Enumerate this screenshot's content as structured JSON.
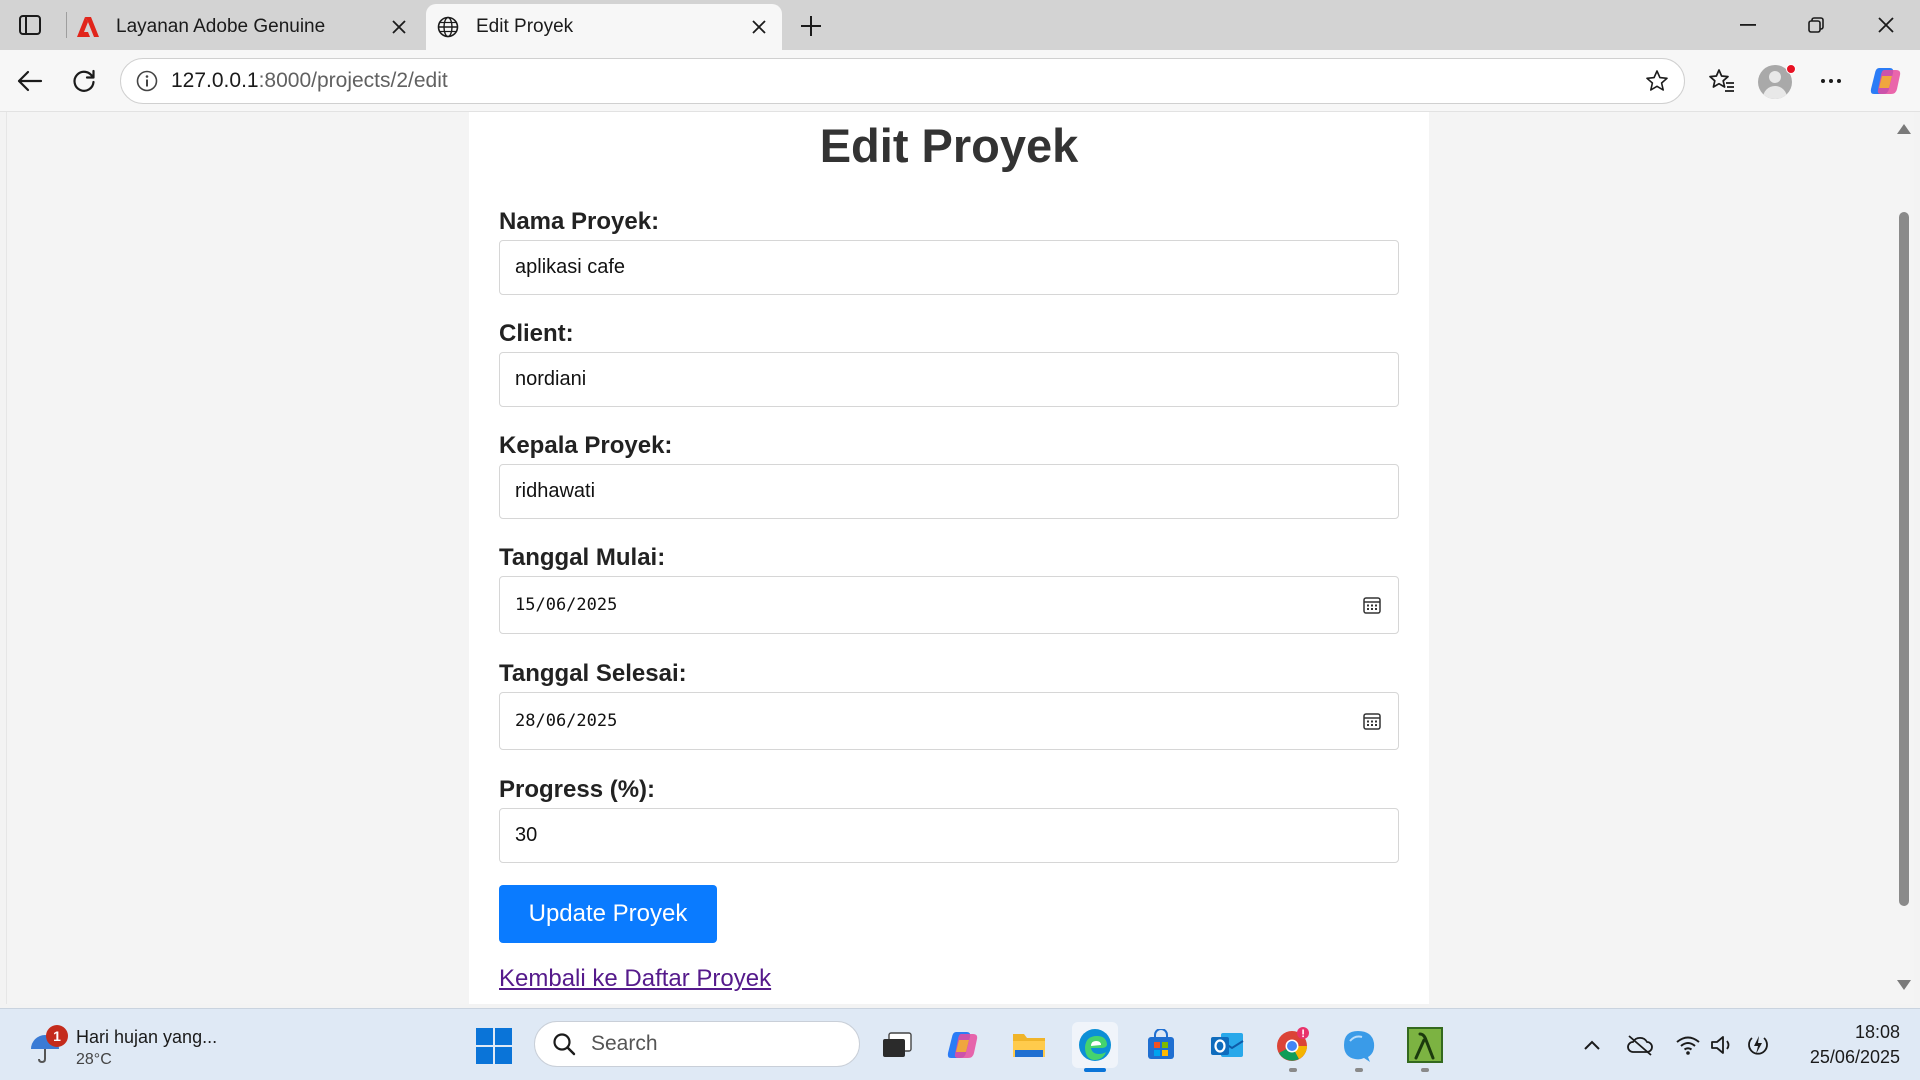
{
  "browser": {
    "tabs": [
      {
        "label": "Layanan Adobe Genuine",
        "active": false
      },
      {
        "label": "Edit Proyek",
        "active": true
      }
    ],
    "url_host": "127.0.0.1",
    "url_path": ":8000/projects/2/edit"
  },
  "page": {
    "title": "Edit Proyek",
    "fields": {
      "nama_proyek": {
        "label": "Nama Proyek:",
        "value": "aplikasi cafe"
      },
      "client": {
        "label": "Client:",
        "value": "nordiani"
      },
      "kepala_proyek": {
        "label": "Kepala Proyek:",
        "value": "ridhawati"
      },
      "tanggal_mulai": {
        "label": "Tanggal Mulai:",
        "value": "15/06/2025"
      },
      "tanggal_selesai": {
        "label": "Tanggal Selesai:",
        "value": "28/06/2025"
      },
      "progress": {
        "label": "Progress (%):",
        "value": "30"
      }
    },
    "submit_label": "Update Proyek",
    "back_link_label": "Kembali ke Daftar Proyek"
  },
  "taskbar": {
    "weather": {
      "title": "Hari hujan yang...",
      "temp": "28°C",
      "badge": "1"
    },
    "search_placeholder": "Search",
    "clock": {
      "time": "18:08",
      "date": "25/06/2025"
    }
  },
  "colors": {
    "primary_button": "#0a7bff",
    "visited_link": "#551a8b",
    "tabbar": "#d3d3d3"
  }
}
